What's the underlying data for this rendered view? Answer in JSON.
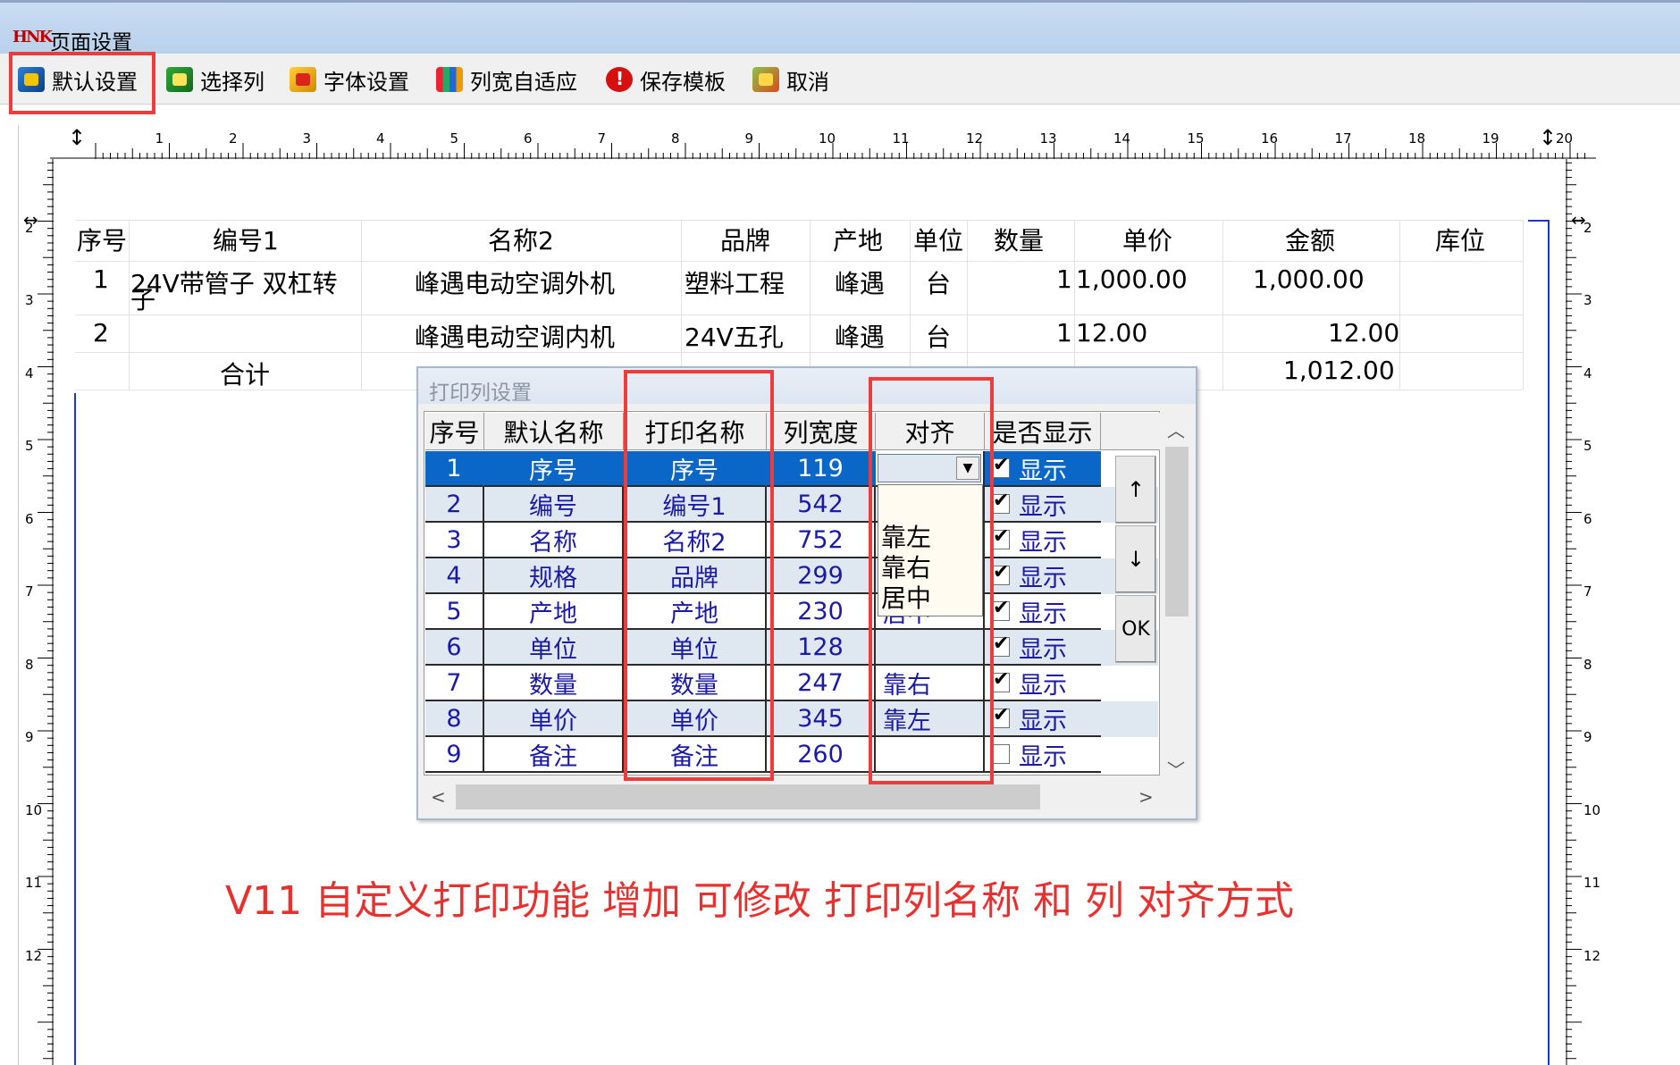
{
  "window": {
    "logo": "HNK",
    "title": "页面设置"
  },
  "toolbar": {
    "default_settings": "默认设置",
    "select_columns": "选择列",
    "font_settings": "字体设置",
    "autofit_width": "列宽自适应",
    "save_template": "保存模板",
    "cancel": "取消"
  },
  "ruler": {
    "top_marks": [
      "1",
      "2",
      "3",
      "4",
      "5",
      "6",
      "7",
      "8",
      "9",
      "10",
      "11",
      "12",
      "13",
      "14",
      "15",
      "16",
      "17",
      "18",
      "19",
      "20"
    ],
    "side_marks": [
      "2",
      "3",
      "4",
      "5",
      "6",
      "7",
      "8",
      "9",
      "10",
      "11",
      "12"
    ]
  },
  "preview": {
    "headers": [
      "序号",
      "编号1",
      "名称2",
      "品牌",
      "产地",
      "单位",
      "数量",
      "单价",
      "金额",
      "库位"
    ],
    "rows": [
      {
        "no": "1",
        "code": "24V带管子 双杠转",
        "code_wrap": "子",
        "name": "峰遇电动空调外机",
        "brand": "塑料工程",
        "origin": "峰遇",
        "unit": "台",
        "qty": "1",
        "price": "1,000.00",
        "amount": "1,000.00"
      },
      {
        "no": "2",
        "code": "",
        "name": "峰遇电动空调内机",
        "brand": "24V五孔",
        "origin": "峰遇",
        "unit": "台",
        "qty": "1",
        "price": "12.00",
        "amount": "12.00"
      }
    ],
    "total_label": "合计",
    "total_amount": "1,012.00"
  },
  "dialog": {
    "title": "打印列设置",
    "columns": [
      "序号",
      "默认名称",
      "打印名称",
      "列宽度",
      "对齐",
      "是否显示"
    ],
    "rows": [
      {
        "no": "1",
        "default": "序号",
        "print": "序号",
        "width": "119",
        "align": "",
        "show": "显示",
        "checked": true
      },
      {
        "no": "2",
        "default": "编号",
        "print": "编号1",
        "width": "542",
        "align": "",
        "show": "显示",
        "checked": true
      },
      {
        "no": "3",
        "default": "名称",
        "print": "名称2",
        "width": "752",
        "align": "",
        "show": "显示",
        "checked": true
      },
      {
        "no": "4",
        "default": "规格",
        "print": "品牌",
        "width": "299",
        "align": "",
        "show": "显示",
        "checked": true
      },
      {
        "no": "5",
        "default": "产地",
        "print": "产地",
        "width": "230",
        "align": "居中",
        "show": "显示",
        "checked": true
      },
      {
        "no": "6",
        "default": "单位",
        "print": "单位",
        "width": "128",
        "align": "",
        "show": "显示",
        "checked": true
      },
      {
        "no": "7",
        "default": "数量",
        "print": "数量",
        "width": "247",
        "align": "靠右",
        "show": "显示",
        "checked": true
      },
      {
        "no": "8",
        "default": "单价",
        "print": "单价",
        "width": "345",
        "align": "靠左",
        "show": "显示",
        "checked": true
      },
      {
        "no": "9",
        "default": "备注",
        "print": "备注",
        "width": "260",
        "align": "",
        "show": "显示",
        "checked": false
      }
    ],
    "align_options": [
      "靠左",
      "靠右",
      "居中"
    ],
    "buttons": {
      "up": "↑",
      "down": "↓",
      "ok": "OK"
    }
  },
  "caption": "V11 自定义打印功能  增加 可修改 打印列名称 和 列 对齐方式",
  "colors": {
    "highlight_box": "#ee3b3b",
    "selection": "#0a67c7",
    "caption": "#e8312f",
    "page_border": "#2233cc"
  }
}
